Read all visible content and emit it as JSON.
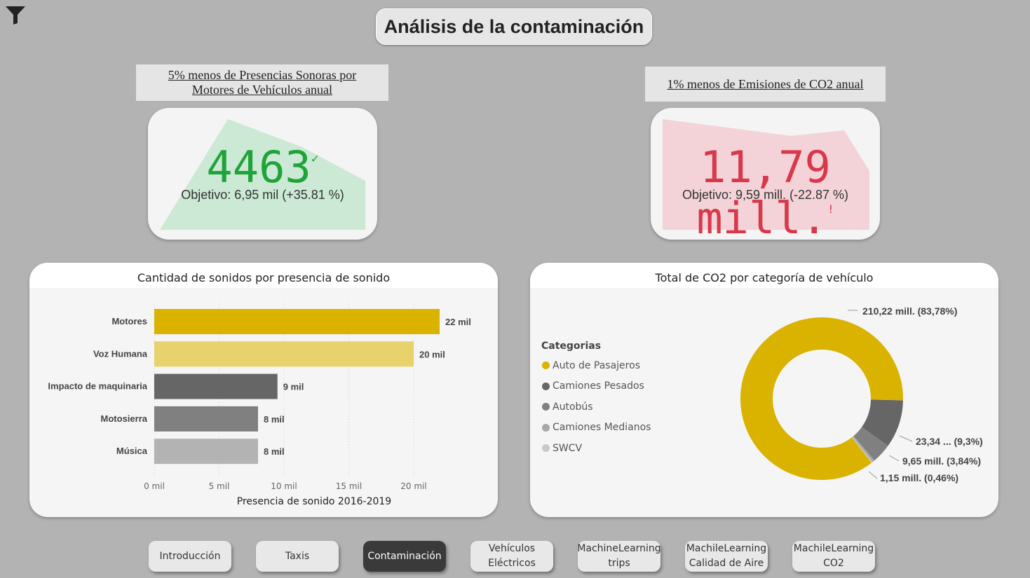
{
  "header": {
    "title": "Análisis de la contaminación"
  },
  "icons": {
    "filter": "filter-icon"
  },
  "kpi_sound": {
    "label": "5% menos de Presencias Sonoras por Motores de Vehículos anual",
    "value": "4463",
    "status_mark": "✓",
    "target": "Objetivo: 6,95 mil (+35.81 %)",
    "value_color": "#1fa43a",
    "fill_color": "#cbe9d4"
  },
  "kpi_co2": {
    "label": "1% menos de Emisiones de CO2 anual",
    "value": "11,79 mill.",
    "status_mark": "!",
    "target": "Objetivo: 9,59 mill. (-22.87 %)",
    "value_color": "#d9384b",
    "fill_color": "#f3d3d7"
  },
  "bar_panel": {
    "title": "Cantidad de sonidos por presencia de sonido"
  },
  "donut_panel": {
    "title": "Total de CO2 por categoría de vehículo",
    "legend_title": "Categorias"
  },
  "chart_data": [
    {
      "type": "bar",
      "orientation": "horizontal",
      "title": "Cantidad de sonidos por presencia de sonido",
      "xlabel": "Presencia de sonido 2016-2019",
      "categories": [
        "Motores",
        "Voz Humana",
        "Impacto de maquinaria",
        "Motosierra",
        "Música"
      ],
      "values": [
        22000,
        20000,
        9500,
        8000,
        8000
      ],
      "data_labels": [
        "22 mil",
        "20 mil",
        "9 mil",
        "8 mil",
        "8 mil"
      ],
      "colors": [
        "#dab200",
        "#e8d26b",
        "#666666",
        "#808080",
        "#b3b3b3"
      ],
      "xlim": [
        0,
        22000
      ],
      "x_ticks": [
        0,
        5000,
        10000,
        15000,
        20000
      ],
      "x_tick_labels": [
        "0 mil",
        "5 mil",
        "10 mil",
        "15 mil",
        "20 mil"
      ],
      "grid": true
    },
    {
      "type": "pie",
      "style": "donut",
      "title": "Total de CO2 por categoría de vehículo",
      "legend_title": "Categorias",
      "categories": [
        "Auto de Pasajeros",
        "Camiones Pesados",
        "Autobús",
        "Camiones Medianos",
        "SWCV"
      ],
      "values": [
        210.22,
        23.34,
        9.65,
        1.15,
        0.6
      ],
      "percent": [
        83.78,
        9.3,
        3.84,
        0.46,
        0.24
      ],
      "colors": [
        "#dab200",
        "#666666",
        "#808080",
        "#a8a8a8",
        "#c8c8c8"
      ],
      "data_labels": [
        "210,22 mill. (83,78%)",
        "23,34 ... (9,3%)",
        "9,65 mill. (3,84%)",
        "1,15 mill. (0,46%)",
        ""
      ],
      "legend_position": "left"
    }
  ],
  "nav": [
    {
      "label": "Introducción",
      "active": false
    },
    {
      "label": "Taxis",
      "active": false
    },
    {
      "label": "Contaminación",
      "active": true
    },
    {
      "label": "Vehículos Eléctricos",
      "active": false
    },
    {
      "label": "MachineLearning trips",
      "active": false
    },
    {
      "label": "MachileLearning Calidad de Aire",
      "active": false
    },
    {
      "label": "MachileLearning CO2",
      "active": false
    }
  ]
}
